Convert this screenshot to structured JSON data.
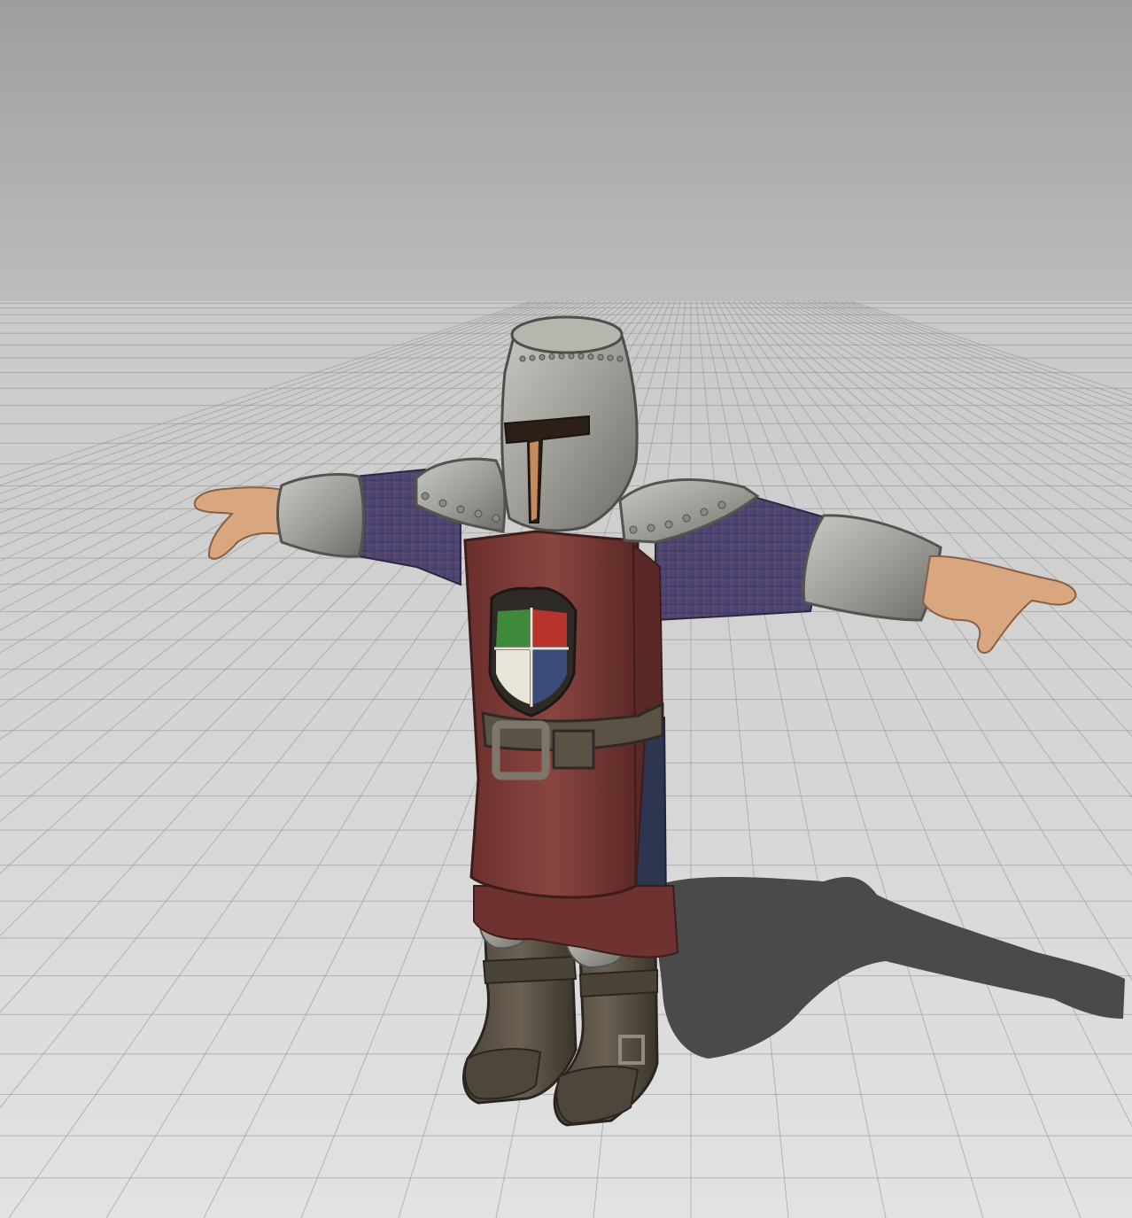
{
  "scene": {
    "colors": {
      "sky_top": "#9e9e9e",
      "sky_horizon": "#cdcdcd",
      "floor_near": "#e2e2e2",
      "floor_far": "#c9c9c9",
      "grid_line": "#8f8f8f",
      "shadow": "#4a4a4a",
      "metal": "#a9a8a2",
      "metal_dark": "#6f6e69",
      "tabard": "#7a3a36",
      "tabard_dark": "#4f2422",
      "sleeve": "#4f4a78",
      "skin": "#d8a57d",
      "leather": "#5a5244",
      "leather_dark": "#38322a"
    },
    "crest": {
      "quarter_colors": [
        "#3f8a3a",
        "#b8332b",
        "#e8e4da",
        "#3b4b7a"
      ]
    }
  }
}
